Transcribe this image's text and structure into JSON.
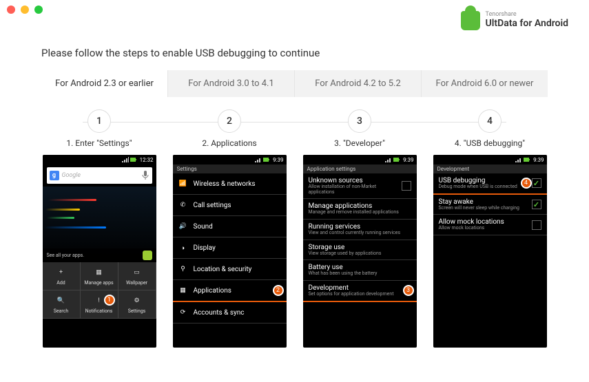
{
  "brand": {
    "sub": "Tenorshare",
    "main": "UltData for Android"
  },
  "heading": "Please follow the steps to enable USB debugging to continue",
  "tabs": [
    {
      "label": "For Android 2.3 or earlier",
      "active": true
    },
    {
      "label": "For Android 3.0 to 4.1",
      "active": false
    },
    {
      "label": "For Android 4.2 to 5.2",
      "active": false
    },
    {
      "label": "For Android 6.0 or newer",
      "active": false
    }
  ],
  "steps": [
    {
      "num": "1",
      "label": "1. Enter \"Settings\""
    },
    {
      "num": "2",
      "label": "2. Applications"
    },
    {
      "num": "3",
      "label": "3. \"Developer\""
    },
    {
      "num": "4",
      "label": "4. \"USB debugging\""
    }
  ],
  "phone1": {
    "time": "12:32",
    "search_placeholder": "Google",
    "hint": "See all your apps.",
    "home": [
      {
        "label": "Add"
      },
      {
        "label": "Manage apps"
      },
      {
        "label": "Wallpaper"
      },
      {
        "label": "Search"
      },
      {
        "label": "Notifications"
      },
      {
        "label": "Settings"
      }
    ],
    "callout": "1"
  },
  "phone2": {
    "time": "9:39",
    "section": "Settings",
    "rows": [
      {
        "title": "Wireless & networks"
      },
      {
        "title": "Call settings"
      },
      {
        "title": "Sound"
      },
      {
        "title": "Display"
      },
      {
        "title": "Location & security"
      },
      {
        "title": "Applications"
      },
      {
        "title": "Accounts & sync"
      }
    ],
    "callout": "2"
  },
  "phone3": {
    "time": "9:39",
    "section": "Application settings",
    "rows": [
      {
        "title": "Unknown sources",
        "sub": "Allow installation of non-Market applications",
        "check": false
      },
      {
        "title": "Manage applications",
        "sub": "Manage and remove installed applications"
      },
      {
        "title": "Running services",
        "sub": "View and control currently running services"
      },
      {
        "title": "Storage use",
        "sub": "View storage used by applications"
      },
      {
        "title": "Battery use",
        "sub": "What has been using the battery"
      },
      {
        "title": "Development",
        "sub": "Set options for application development"
      }
    ],
    "callout": "3"
  },
  "phone4": {
    "time": "9:39",
    "section": "Development",
    "rows": [
      {
        "title": "USB debugging",
        "sub": "Debug mode when USB is connected",
        "check": true
      },
      {
        "title": "Stay awake",
        "sub": "Screen will never sleep while charging",
        "check": true
      },
      {
        "title": "Allow mock locations",
        "sub": "Allow mock locations",
        "check": false
      }
    ],
    "callout": "4"
  }
}
